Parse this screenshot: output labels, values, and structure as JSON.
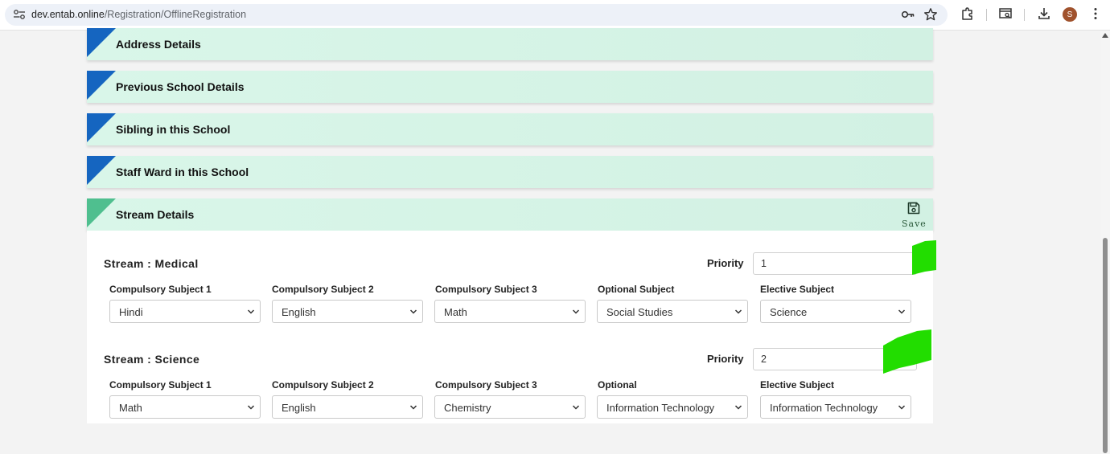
{
  "browser": {
    "url_host": "dev.entab.online",
    "url_path": "/Registration/OfflineRegistration",
    "avatar_letter": "S"
  },
  "sections": [
    {
      "title": "Address Details"
    },
    {
      "title": "Previous School Details"
    },
    {
      "title": "Sibling in this School"
    },
    {
      "title": "Staff Ward in this School"
    },
    {
      "title": "Stream Details"
    }
  ],
  "save_label": "Save",
  "streams": [
    {
      "title": "Stream : Medical",
      "priority_label": "Priority",
      "priority_value": "1",
      "fields": [
        {
          "label": "Compulsory Subject 1",
          "value": "Hindi"
        },
        {
          "label": "Compulsory Subject 2",
          "value": "English"
        },
        {
          "label": "Compulsory Subject 3",
          "value": "Math"
        },
        {
          "label": "Optional Subject",
          "value": "Social Studies"
        },
        {
          "label": "Elective Subject",
          "value": "Science"
        }
      ]
    },
    {
      "title": "Stream : Science",
      "priority_label": "Priority",
      "priority_value": "2",
      "fields": [
        {
          "label": "Compulsory Subject 1",
          "value": "Math"
        },
        {
          "label": "Compulsory Subject 2",
          "value": "English"
        },
        {
          "label": "Compulsory Subject 3",
          "value": "Chemistry"
        },
        {
          "label": "Optional",
          "value": "Information Technology"
        },
        {
          "label": "Elective Subject",
          "value": "Information Technology"
        }
      ]
    }
  ],
  "colors": {
    "header_bg": "#d9f6e9",
    "corner_blue": "#1565c0",
    "corner_green": "#4fbf8f",
    "annotation_green": "#22dd00"
  }
}
